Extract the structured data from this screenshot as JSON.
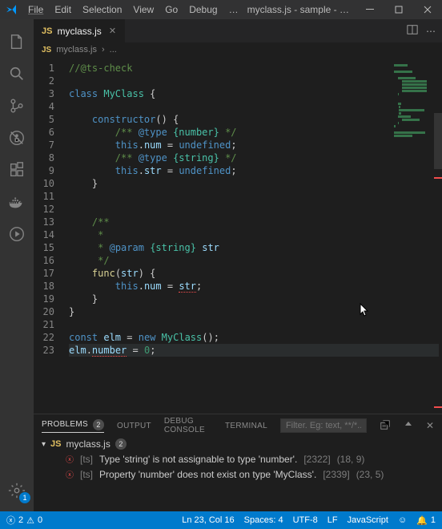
{
  "menu": {
    "items": [
      "File",
      "Edit",
      "Selection",
      "View",
      "Go",
      "Debug",
      "…"
    ]
  },
  "window_title": "myclass.js - sample - Visual...",
  "activity": {
    "settings_badge": "1"
  },
  "tab": {
    "icon_label": "JS",
    "name": "myclass.js"
  },
  "breadcrumb": {
    "icon_label": "JS",
    "file": "myclass.js",
    "sep": "›",
    "more": "..."
  },
  "code_lines": [
    {
      "n": 1,
      "html": "<span class='c-comment'>//@ts-check</span>"
    },
    {
      "n": 2,
      "html": ""
    },
    {
      "n": 3,
      "html": "<span class='c-keyword'>class</span> <span class='c-class'>MyClass</span> <span class='c-punc'>{</span>"
    },
    {
      "n": 4,
      "html": ""
    },
    {
      "n": 5,
      "html": "    <span class='c-keyword'>constructor</span><span class='c-punc'>() {</span>"
    },
    {
      "n": 6,
      "html": "        <span class='c-comment'>/** <span class='c-keyword'>@type</span> <span class='c-class'>{number}</span> */</span>"
    },
    {
      "n": 7,
      "html": "        <span class='c-this'>this</span><span class='c-punc'>.</span><span class='c-var'>num</span> <span class='c-punc'>=</span> <span class='c-undef'>undefined</span><span class='c-punc'>;</span>"
    },
    {
      "n": 8,
      "html": "        <span class='c-comment'>/** <span class='c-keyword'>@type</span> <span class='c-class'>{string}</span> */</span>"
    },
    {
      "n": 9,
      "html": "        <span class='c-this'>this</span><span class='c-punc'>.</span><span class='c-var'>str</span> <span class='c-punc'>=</span> <span class='c-undef'>undefined</span><span class='c-punc'>;</span>"
    },
    {
      "n": 10,
      "html": "    <span class='c-punc'>}</span>"
    },
    {
      "n": 11,
      "html": ""
    },
    {
      "n": 12,
      "html": ""
    },
    {
      "n": 13,
      "html": "    <span class='c-comment'>/**</span>"
    },
    {
      "n": 14,
      "html": "    <span class='c-comment'> *</span>"
    },
    {
      "n": 15,
      "html": "    <span class='c-comment'> * <span class='c-keyword'>@param</span> <span class='c-class'>{string}</span> <span class='c-var'>str</span></span>"
    },
    {
      "n": 16,
      "html": "    <span class='c-comment'> */</span>"
    },
    {
      "n": 17,
      "html": "    <span class='c-func'>func</span><span class='c-punc'>(</span><span class='c-var'>str</span><span class='c-punc'>) {</span>"
    },
    {
      "n": 18,
      "html": "        <span class='c-this'>this</span><span class='c-punc'>.</span><span class='c-var'>num</span> <span class='c-punc'>=</span> <span class='c-var c-err'>str</span><span class='c-punc'>;</span>"
    },
    {
      "n": 19,
      "html": "    <span class='c-punc'>}</span>"
    },
    {
      "n": 20,
      "html": "<span class='c-punc'>}</span>"
    },
    {
      "n": 21,
      "html": ""
    },
    {
      "n": 22,
      "html": "<span class='c-keyword'>const</span> <span class='c-var'>elm</span> <span class='c-punc'>=</span> <span class='c-keyword'>new</span> <span class='c-class'>MyClass</span><span class='c-punc'>();</span>"
    },
    {
      "n": 23,
      "html": "<span class='c-var'>elm</span><span class='c-punc'>.</span><span class='c-var c-err'>number</span> <span class='c-punc'>=</span> <span class='c-str'>0</span><span class='c-punc'>;</span>",
      "hl": true
    }
  ],
  "panel": {
    "tabs": {
      "problems": "PROBLEMS",
      "output": "OUTPUT",
      "debug": "DEBUG CONSOLE",
      "terminal": "TERMINAL",
      "problems_badge": "2"
    },
    "filter_placeholder": "Filter. Eg: text, **/*....",
    "file": {
      "icon_label": "JS",
      "name": "myclass.js",
      "badge": "2"
    },
    "errors": [
      {
        "src": "[ts]",
        "msg": "Type 'string' is not assignable to type 'number'.",
        "code": "[2322]",
        "loc": "(18, 9)"
      },
      {
        "src": "[ts]",
        "msg": "Property 'number' does not exist on type 'MyClass'.",
        "code": "[2339]",
        "loc": "(23, 5)"
      }
    ]
  },
  "status": {
    "errors": "2",
    "warnings": "0",
    "ln_col": "Ln 23, Col 16",
    "spaces": "Spaces: 4",
    "encoding": "UTF-8",
    "eol": "LF",
    "lang": "JavaScript",
    "bell": "1"
  }
}
